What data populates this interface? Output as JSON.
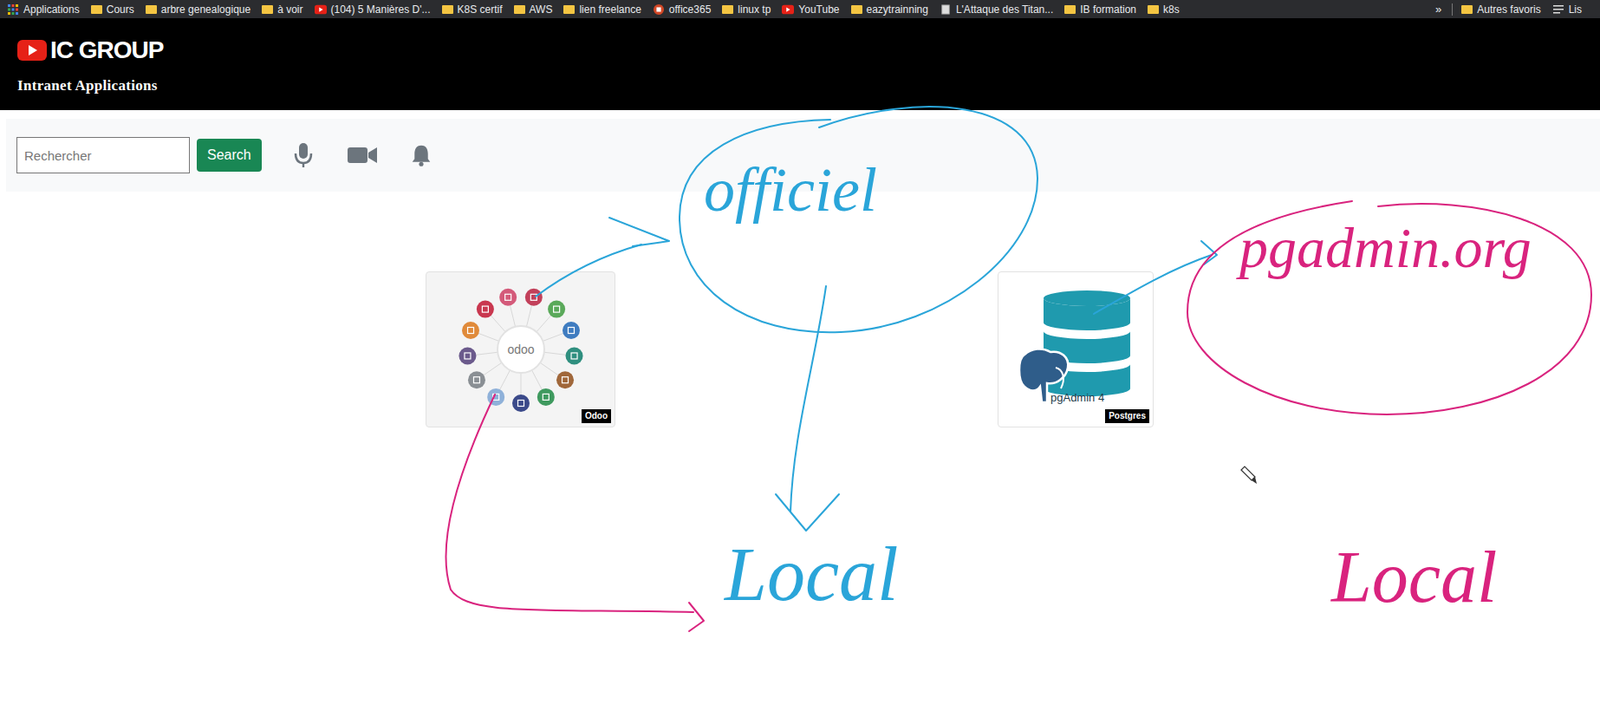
{
  "bookmarks": [
    {
      "label": "Applications",
      "kind": "apps"
    },
    {
      "label": "Cours",
      "kind": "folder"
    },
    {
      "label": "arbre genealogique",
      "kind": "folder"
    },
    {
      "label": "à voir",
      "kind": "folder"
    },
    {
      "label": "(104) 5 Manières D'...",
      "kind": "youtube"
    },
    {
      "label": "K8S certif",
      "kind": "folder"
    },
    {
      "label": "AWS",
      "kind": "folder"
    },
    {
      "label": "lien freelance",
      "kind": "folder"
    },
    {
      "label": "office365",
      "kind": "office"
    },
    {
      "label": "linux tp",
      "kind": "folder"
    },
    {
      "label": "YouTube",
      "kind": "youtube"
    },
    {
      "label": "eazytrainning",
      "kind": "folder"
    },
    {
      "label": "L'Attaque des Titan...",
      "kind": "page"
    },
    {
      "label": "IB formation",
      "kind": "folder"
    },
    {
      "label": "k8s",
      "kind": "folder"
    }
  ],
  "bookmarks_overflow": "»",
  "bookmarks_right": [
    {
      "label": "Autres favoris",
      "kind": "folder"
    },
    {
      "label": "Lis",
      "kind": "list"
    }
  ],
  "header": {
    "brand": "IC GROUP",
    "subtitle": "Intranet Applications"
  },
  "search": {
    "placeholder": "Rechercher",
    "button": "Search"
  },
  "apps": [
    {
      "name": "odoo",
      "badge": "Odoo",
      "kind": "odoo"
    },
    {
      "name": "pgAdmin 4",
      "badge": "Postgres",
      "kind": "pgadmin"
    }
  ],
  "annotations": [
    {
      "text": "officiel",
      "color": "#2aa5d9"
    },
    {
      "text": "pgadmin.org",
      "color": "#d9237e"
    },
    {
      "text": "Local",
      "color": "#2aa5d9"
    },
    {
      "text": "Local",
      "color": "#d9237e"
    }
  ]
}
